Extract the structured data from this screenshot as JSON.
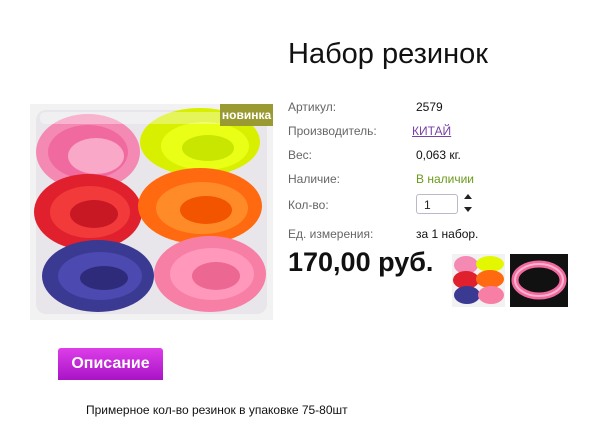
{
  "product": {
    "title": "Набор резинок",
    "badge": "новинка",
    "price": "170,00 руб."
  },
  "specs": {
    "article": {
      "label": "Артикул:",
      "value": "2579"
    },
    "manufacturer": {
      "label": "Производитель:",
      "value": "КИТАЙ"
    },
    "weight": {
      "label": "Вес:",
      "value": "0,063 кг."
    },
    "availability": {
      "label": "Наличие:",
      "value": "В наличии"
    },
    "quantity": {
      "label": "Кол-во:",
      "value": "1"
    },
    "unit": {
      "label": "Ед. измерения:",
      "value": "за 1 набор."
    }
  },
  "tabs": {
    "description_label": "Описание",
    "description_text": "Примерное кол-во резинок в упаковке 75-80шт"
  },
  "colors": {
    "badge": "#9a9a32",
    "link": "#7a3fa8",
    "in_stock": "#6b9a1a",
    "tab": "#c42ad6"
  }
}
